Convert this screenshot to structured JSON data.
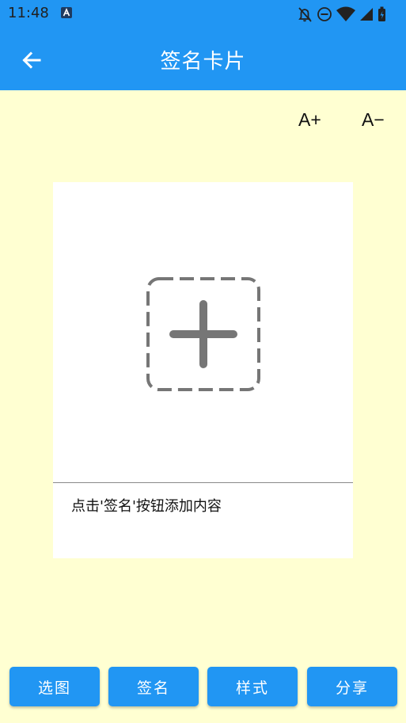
{
  "status_bar": {
    "time": "11:48",
    "notification_icon": "a-app-icon",
    "icons": [
      "bell-off-icon",
      "do-not-disturb-icon",
      "wifi-icon",
      "signal-icon",
      "battery-icon"
    ]
  },
  "app_bar": {
    "title": "签名卡片",
    "back_icon": "arrow-left-icon",
    "color": "#2196f3"
  },
  "font_controls": {
    "increase_label": "A+",
    "decrease_label": "A−"
  },
  "card": {
    "add_icon": "add-image-icon",
    "placeholder_text": "点击'签名'按钮添加内容"
  },
  "bottom_buttons": {
    "select_image": "选图",
    "signature": "签名",
    "style": "样式",
    "share": "分享"
  },
  "colors": {
    "background": "#ffffd2",
    "accent": "#2196f3"
  }
}
